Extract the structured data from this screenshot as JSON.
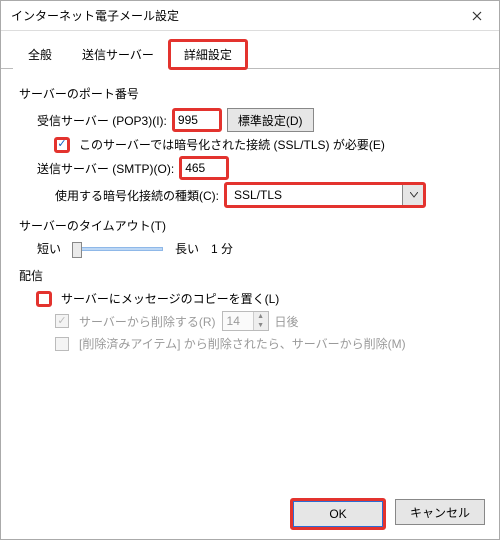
{
  "window": {
    "title": "インターネット電子メール設定"
  },
  "tabs": {
    "general": "全般",
    "outgoing": "送信サーバー",
    "advanced": "詳細設定"
  },
  "ports": {
    "group_label": "サーバーのポート番号",
    "incoming_label": "受信サーバー (POP3)(I):",
    "incoming_value": "995",
    "defaults_button": "標準設定(D)",
    "ssl_required_label": "このサーバーでは暗号化された接続 (SSL/TLS) が必要(E)",
    "outgoing_label": "送信サーバー (SMTP)(O):",
    "outgoing_value": "465",
    "encryption_label": "使用する暗号化接続の種類(C):",
    "encryption_value": "SSL/TLS"
  },
  "timeout": {
    "group_label": "サーバーのタイムアウト(T)",
    "short_label": "短い",
    "long_label": "長い",
    "value_text": "1 分"
  },
  "delivery": {
    "group_label": "配信",
    "leave_copy_label": "サーバーにメッセージのコピーを置く(L)",
    "remove_after_label": "サーバーから削除する(R)",
    "remove_after_days": "14",
    "days_suffix": "日後",
    "remove_on_deleted_label": "[削除済みアイテム] から削除されたら、サーバーから削除(M)"
  },
  "footer": {
    "ok": "OK",
    "cancel": "キャンセル"
  }
}
